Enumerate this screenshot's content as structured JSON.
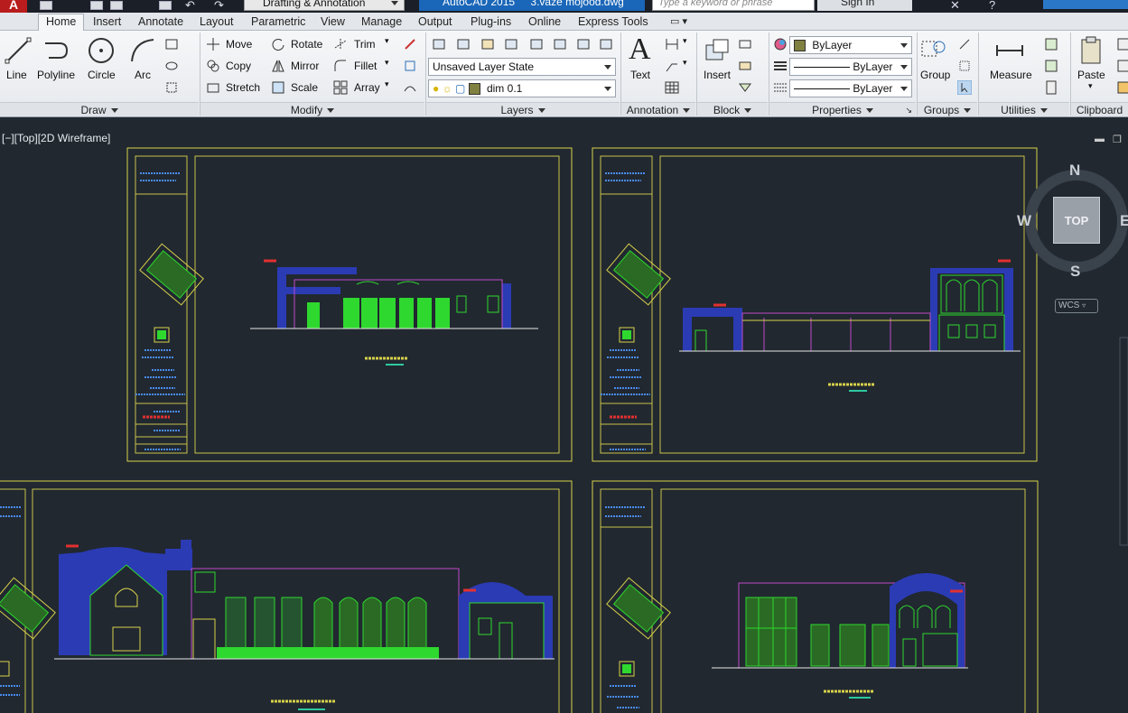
{
  "titlebar": {
    "workspace": "Drafting & Annotation",
    "app_version": "AutoCAD 2015",
    "file_name": "3.vaze mojood.dwg",
    "search_placeholder": "Type a keyword or phrase",
    "sign_in": "Sign In"
  },
  "tabs": [
    "Home",
    "Insert",
    "Annotate",
    "Layout",
    "Parametric",
    "View",
    "Manage",
    "Output",
    "Plug-ins",
    "Online",
    "Express Tools"
  ],
  "ribbon": {
    "draw": {
      "label": "Draw",
      "line": "Line",
      "polyline": "Polyline",
      "circle": "Circle",
      "arc": "Arc"
    },
    "modify": {
      "label": "Modify",
      "move": "Move",
      "rotate": "Rotate",
      "trim": "Trim",
      "copy": "Copy",
      "mirror": "Mirror",
      "fillet": "Fillet",
      "stretch": "Stretch",
      "scale": "Scale",
      "array": "Array"
    },
    "layers": {
      "label": "Layers",
      "layer_state": "Unsaved Layer State",
      "current_layer": "dim 0.1"
    },
    "annotation": {
      "label": "Annotation",
      "text": "Text"
    },
    "block": {
      "label": "Block",
      "insert": "Insert"
    },
    "properties": {
      "label": "Properties",
      "color": "ByLayer",
      "linetype": "ByLayer",
      "lineweight": "ByLayer"
    },
    "groups": {
      "label": "Groups",
      "group": "Group"
    },
    "utilities": {
      "label": "Utilities",
      "measure": "Measure"
    },
    "clipboard": {
      "label": "Clipboard",
      "paste": "Paste"
    }
  },
  "viewport": {
    "label": "[−][Top][2D Wireframe]",
    "viewcube": {
      "face": "TOP",
      "north": "N",
      "south": "S",
      "east": "E",
      "west": "W"
    },
    "wcs": "WCS"
  },
  "colors": {
    "background": "#212830",
    "frame": "#d8d24a",
    "building_blue": "#2b3bb4",
    "green": "#2ed82e",
    "magenta": "#c04ac8"
  }
}
